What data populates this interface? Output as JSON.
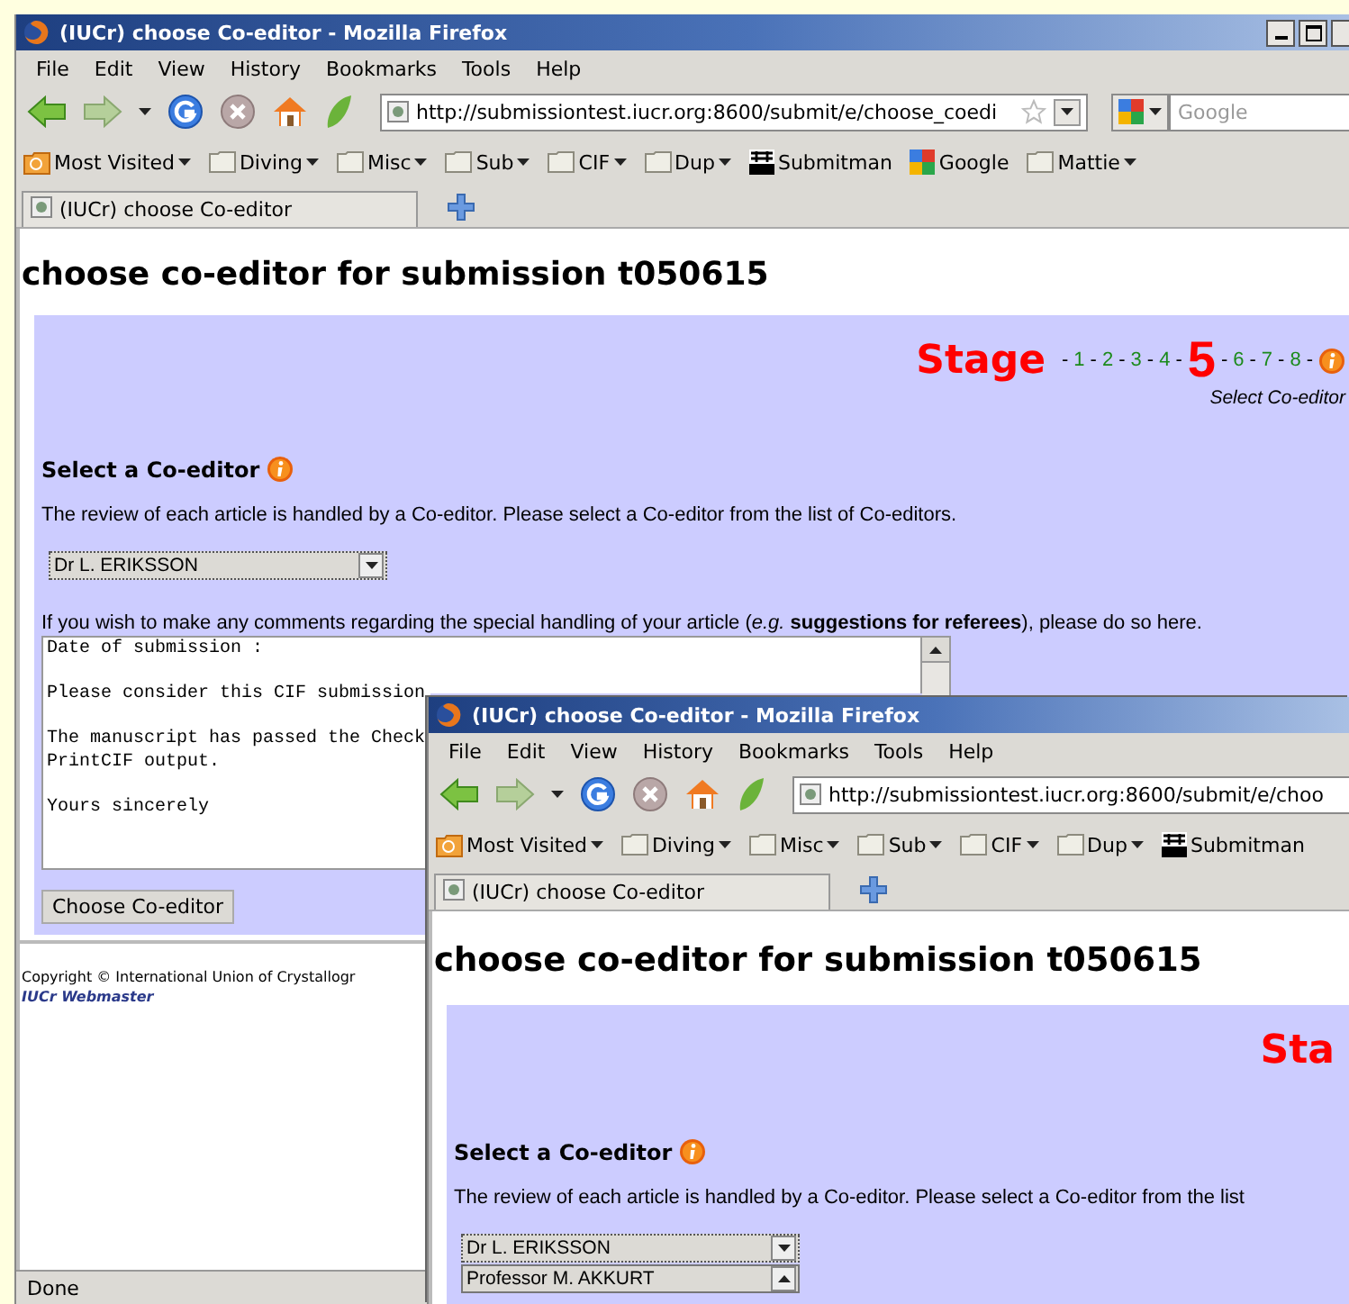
{
  "windows": [
    {
      "title": "(IUCr) choose Co-editor - Mozilla Firefox",
      "controls": true,
      "menu": [
        "File",
        "Edit",
        "View",
        "History",
        "Bookmarks",
        "Tools",
        "Help"
      ],
      "url": "http://submissiontest.iucr.org:8600/submit/e/choose_coedi",
      "search": {
        "placeholder": "Google"
      },
      "bookmarks": [
        {
          "label": "Most Visited",
          "kind": "smart",
          "menu": true
        },
        {
          "label": "Diving",
          "kind": "folder",
          "menu": true
        },
        {
          "label": "Misc",
          "kind": "folder",
          "menu": true
        },
        {
          "label": "Sub",
          "kind": "folder",
          "menu": true
        },
        {
          "label": "CIF",
          "kind": "folder",
          "menu": true
        },
        {
          "label": "Dup",
          "kind": "folder",
          "menu": true
        },
        {
          "label": "Submitman",
          "kind": "mono",
          "menu": false
        },
        {
          "label": "Google",
          "kind": "tiles",
          "menu": false
        },
        {
          "label": "Mattie",
          "kind": "folder",
          "menu": true
        }
      ],
      "tab": "(IUCr) choose Co-editor",
      "page": {
        "heading": "choose co-editor for submission t050615",
        "stage": {
          "label": "Stage",
          "separator": "-",
          "steps": [
            {
              "label": "1",
              "selected": false
            },
            {
              "label": "2",
              "selected": false
            },
            {
              "label": "3",
              "selected": false
            },
            {
              "label": "4",
              "selected": false
            },
            {
              "label": "5",
              "selected": true
            },
            {
              "label": "6",
              "selected": false
            },
            {
              "label": "7",
              "selected": false
            },
            {
              "label": "8",
              "selected": false
            }
          ],
          "caption": "Select Co-editor"
        },
        "section_title": "Select a Co-editor",
        "intro": "The review of each article is handled by a Co-editor. Please select a Co-editor from the list of Co-editors.",
        "select_value": "Dr L. ERIKSSON",
        "comments_prompt": "If you wish to make any comments regarding the special handling of your article (*e.g.* **suggestions for referees**), please do so here.",
        "comments": [
          [
            "Date of submission :"
          ],
          [
            "Please consider this CIF submission"
          ],
          [
            "The manuscript has passed the Check",
            "PrintCIF output."
          ],
          [
            "Yours sincerely"
          ]
        ],
        "button": "Choose Co-editor",
        "footer": {
          "copyright": "Copyright © International Union of Crystallogr",
          "link": "IUCr Webmaster"
        }
      },
      "status_bar": "Done"
    },
    {
      "title": "(IUCr) choose Co-editor - Mozilla Firefox",
      "controls": false,
      "menu": [
        "File",
        "Edit",
        "View",
        "History",
        "Bookmarks",
        "Tools",
        "Help"
      ],
      "url": "http://submissiontest.iucr.org:8600/submit/e/choo",
      "bookmarks": [
        {
          "label": "Most Visited",
          "kind": "smart",
          "menu": true
        },
        {
          "label": "Diving",
          "kind": "folder",
          "menu": true
        },
        {
          "label": "Misc",
          "kind": "folder",
          "menu": true
        },
        {
          "label": "Sub",
          "kind": "folder",
          "menu": true
        },
        {
          "label": "CIF",
          "kind": "folder",
          "menu": true
        },
        {
          "label": "Dup",
          "kind": "folder",
          "menu": true
        },
        {
          "label": "Submitman",
          "kind": "mono",
          "menu": false
        }
      ],
      "tab": "(IUCr) choose Co-editor",
      "page": {
        "heading": "choose co-editor for submission t050615",
        "stage": {
          "label": "Sta"
        },
        "section_title": "Select a Co-editor",
        "intro": "The review of each article is handled by a Co-editor. Please select a Co-editor from the list",
        "select_value": "Dr L. ERIKSSON",
        "list_options": [
          "Professor M. AKKURT"
        ]
      }
    }
  ]
}
